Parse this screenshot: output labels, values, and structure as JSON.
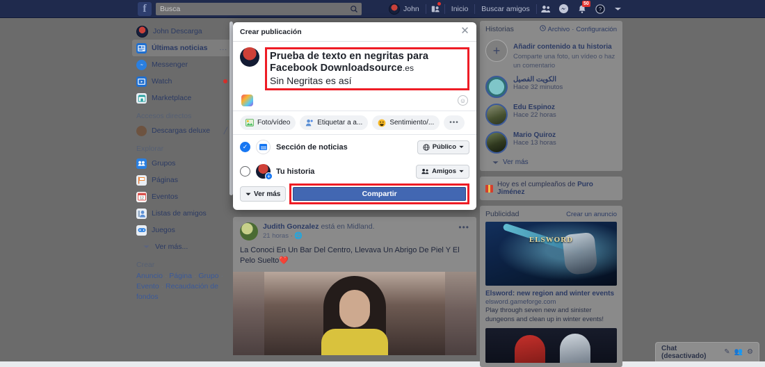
{
  "topbar": {
    "logo": "f",
    "search": {
      "placeholder": "Busca",
      "value": "",
      "icon": "search-icon"
    },
    "profile_name": "John",
    "home_label": "Inicio",
    "find_friends_label": "Buscar amigos",
    "friend_requests_icon": "friend-requests-icon",
    "messenger_icon": "messenger-icon",
    "notifications_icon": "notifications-bell-icon",
    "notifications_badge": "50",
    "help_icon": "help-icon",
    "account_menu_icon": "chevron-down-icon"
  },
  "sidebar": {
    "profile": {
      "label": "John Descarga",
      "icon": "avatar"
    },
    "items": [
      {
        "label": "Últimas noticias",
        "icon": "news-feed-icon",
        "selected": true,
        "trailing": "..."
      },
      {
        "label": "Messenger",
        "icon": "messenger-icon",
        "selected": false
      },
      {
        "label": "Watch",
        "icon": "watch-icon",
        "selected": false,
        "dot": true
      },
      {
        "label": "Marketplace",
        "icon": "marketplace-icon",
        "selected": false
      }
    ],
    "shortcuts_heading": "Accesos directos",
    "shortcuts": [
      {
        "label": "Descargas deluxe",
        "icon": "page-avatar",
        "muted_icon": "muted-icon"
      }
    ],
    "explore_heading": "Explorar",
    "explore": [
      {
        "label": "Grupos",
        "icon": "groups-icon"
      },
      {
        "label": "Páginas",
        "icon": "pages-icon"
      },
      {
        "label": "Eventos",
        "icon": "events-icon"
      },
      {
        "label": "Listas de amigos",
        "icon": "friend-lists-icon"
      },
      {
        "label": "Juegos",
        "icon": "games-icon"
      }
    ],
    "see_more": "Ver más...",
    "create_heading": "Crear",
    "create_links": [
      "Anuncio",
      "Página",
      "Grupo",
      "Evento",
      "Recaudación de fondos"
    ]
  },
  "modal": {
    "title": "Crear publicación",
    "close_icon": "close-icon",
    "author_avatar": "avatar",
    "post_text_bold_line1": "Prueba de texto en negritas para",
    "post_text_bold_line2": "Facebook Downloadsource",
    "post_text_bold_suffix": ".es",
    "post_text_plain": "Sin Negritas es así",
    "background_icon": "color-background-icon",
    "emoji_icon": "emoji-icon",
    "actions": [
      {
        "label": "Foto/vídeo",
        "icon": "photo-video-icon"
      },
      {
        "label": "Etiquetar a a...",
        "icon": "tag-friends-icon"
      },
      {
        "label": "Sentimiento/...",
        "icon": "feeling-activity-icon"
      },
      {
        "label": "•••",
        "icon": "more-options-icon"
      }
    ],
    "audience": [
      {
        "label": "Sección de noticias",
        "selected": true,
        "icon": "news-feed-icon",
        "privacy": "Público",
        "privacy_icon": "globe-icon"
      },
      {
        "label": "Tu historia",
        "selected": false,
        "icon": "story-avatar",
        "privacy": "Amigos",
        "privacy_icon": "friends-icon"
      }
    ],
    "see_more_label": "Ver más",
    "share_label": "Compartir"
  },
  "feed_post": {
    "author": "Judith Gonzalez",
    "action_text": "está en Midland.",
    "time": "21 horas",
    "privacy_icon": "globe-icon",
    "menu_icon": "more-options-icon",
    "text": "La Conoci En Un Bar Del Centro, Llevava Un Abrigo De Piel Y El Pelo Suelto❤️"
  },
  "right": {
    "stories": {
      "title": "Historias",
      "archive_label": "Archivo",
      "archive_icon": "clock-icon",
      "separator": "·",
      "settings_label": "Configuración",
      "add": {
        "title": "Añadir contenido a tu historia",
        "subtitle": "Comparte una foto, un vídeo o haz un comentario",
        "icon": "plus-icon"
      },
      "items": [
        {
          "name": "الكويت الفصيل",
          "time": "Hace 32 minutos"
        },
        {
          "name": "Edu Espinoz",
          "time": "Hace 22 horas"
        },
        {
          "name": "Mario Quiroz",
          "time": "Hace 13 horas"
        }
      ],
      "see_more": "Ver más"
    },
    "birthday": {
      "icon": "gift-icon",
      "text_prefix": "Hoy es el cumpleaños de ",
      "name": "Puro Jiménez"
    },
    "ad": {
      "title": "Publicidad",
      "create_link": "Crear un anuncio",
      "image_logo": "ELSWORD",
      "headline": "Elsword: new region and winter events",
      "url": "elsword.gameforge.com",
      "description": "Play through seven new and sinister dungeons and clean up in winter events!"
    }
  },
  "chat": {
    "label": "Chat (desactivado)",
    "icons": [
      "new-message-icon",
      "contacts-icon",
      "settings-icon"
    ]
  },
  "colors": {
    "header_blue": "#1f2a4d",
    "fb_blue": "#3b5998",
    "primary_blue": "#1877f2",
    "share_blue": "#4267b2",
    "highlight_red": "#ee1c25",
    "badge_red": "#e4342f"
  }
}
